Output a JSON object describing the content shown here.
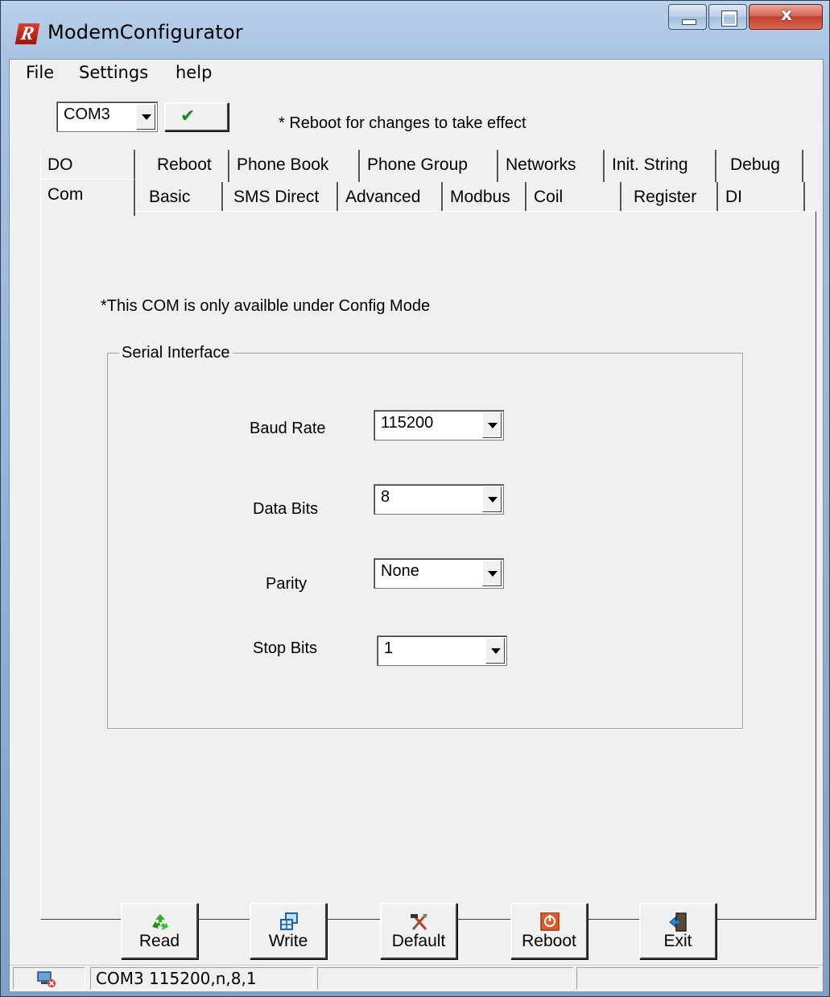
{
  "window": {
    "title": "ModemConfigurator",
    "logo_letter": "R",
    "close_glyph": "x"
  },
  "menu": [
    "File",
    "Settings",
    "help"
  ],
  "toolbar": {
    "port": "COM3",
    "apply_glyph": "✔",
    "note": "* Reboot for changes to take effect"
  },
  "tabs": {
    "row1": [
      "DO",
      "Reboot",
      "Phone Book",
      "Phone Group",
      "Networks",
      "Init. String",
      "Debug"
    ],
    "row2": [
      "Com",
      "Basic",
      "SMS Direct",
      "Advanced",
      "Modbus",
      "Coil",
      "Register",
      "DI"
    ],
    "active": "Com"
  },
  "panel": {
    "note": "*This COM is only availble under Config Mode",
    "group_title": "Serial Interface",
    "fields": [
      {
        "label": "Baud Rate",
        "value": "115200"
      },
      {
        "label": "Data Bits",
        "value": "8"
      },
      {
        "label": "Parity",
        "value": "None"
      },
      {
        "label": "Stop Bits",
        "value": "1"
      }
    ]
  },
  "buttons": [
    "Read",
    "Write",
    "Default",
    "Reboot",
    "Exit"
  ],
  "status": {
    "text": "COM3 115200,n,8,1"
  },
  "colors": {
    "title_bar": "#a9c4e2",
    "close_button": "#c4402d",
    "apply_check": "#1a8a1a",
    "face": "#f0f0f0"
  }
}
